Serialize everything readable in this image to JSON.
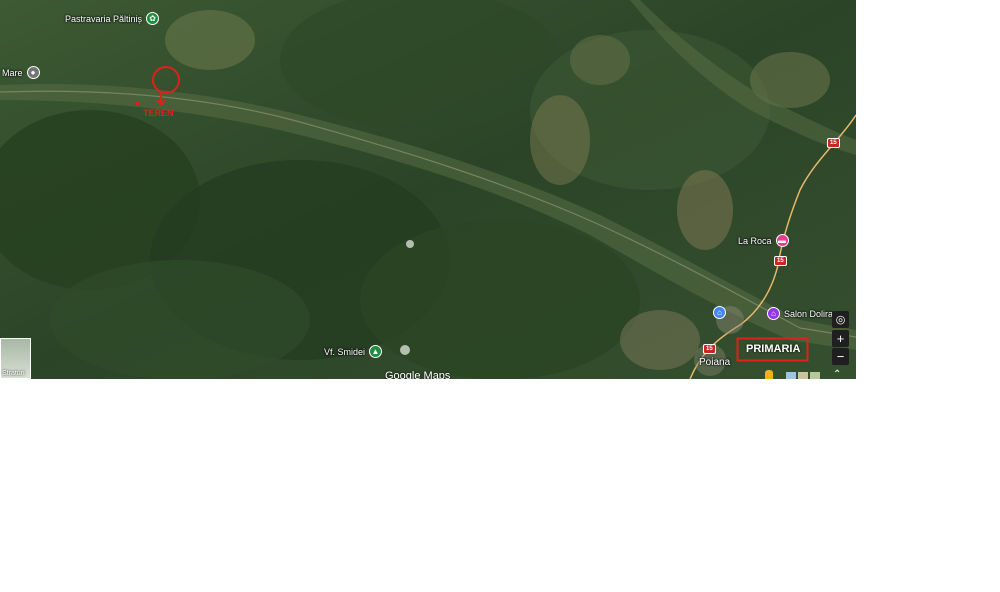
{
  "map": {
    "places": {
      "pastravaria": "Pastravaria Păltiniș",
      "mare": "Mare",
      "la_roca": "La Roca",
      "salon_dolira": "Salon Dolira",
      "vf_smidei": "Vf. Smidei",
      "poiana": "Poiana"
    },
    "annotations": {
      "teren": "TEREN",
      "primaria": "PRIMARIA"
    },
    "road_shields": [
      "15",
      "15",
      "15"
    ],
    "attribution": "Google Maps",
    "layers_label": "Straturi",
    "zoom_in": "+",
    "zoom_out": "−",
    "colors": {
      "annotation": "#e0201a",
      "pin_green": "#1e8e3e",
      "pin_pink": "#e63c8f",
      "pin_purple": "#9334e6",
      "pin_blue": "#4285f4",
      "road": "#e8b86a"
    }
  }
}
